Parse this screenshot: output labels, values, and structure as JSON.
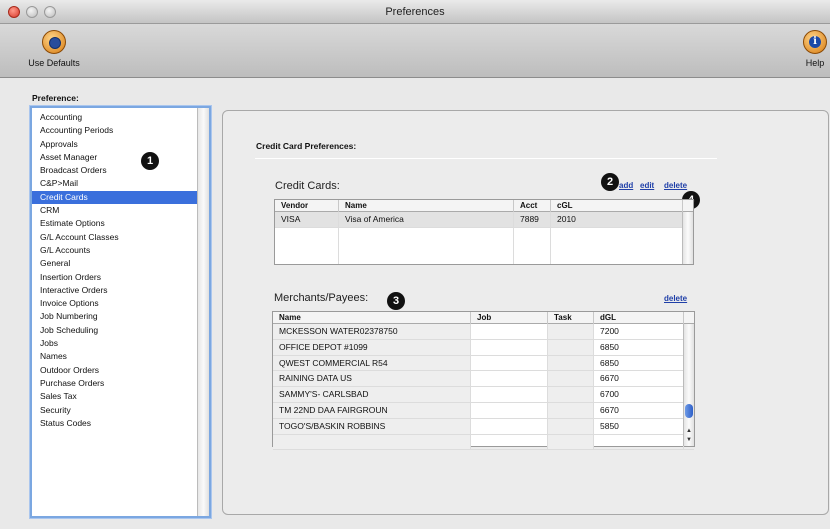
{
  "window": {
    "title": "Preferences"
  },
  "toolbar": {
    "use_defaults_label": "Use Defaults",
    "help_label": "Help"
  },
  "sidebar": {
    "label": "Preference:",
    "items": [
      {
        "label": "Accounting"
      },
      {
        "label": "Accounting Periods"
      },
      {
        "label": "Approvals"
      },
      {
        "label": "Asset Manager"
      },
      {
        "label": "Broadcast Orders"
      },
      {
        "label": "C&P>Mail"
      },
      {
        "label": "Credit Cards"
      },
      {
        "label": "CRM"
      },
      {
        "label": "Estimate Options"
      },
      {
        "label": "G/L Account Classes"
      },
      {
        "label": "G/L Accounts"
      },
      {
        "label": "General"
      },
      {
        "label": "Insertion Orders"
      },
      {
        "label": "Interactive Orders"
      },
      {
        "label": "Invoice Options"
      },
      {
        "label": "Job Numbering"
      },
      {
        "label": "Job Scheduling"
      },
      {
        "label": "Jobs"
      },
      {
        "label": "Names"
      },
      {
        "label": "Outdoor Orders"
      },
      {
        "label": "Purchase Orders"
      },
      {
        "label": "Sales Tax"
      },
      {
        "label": "Security"
      },
      {
        "label": "Status Codes"
      }
    ],
    "selected": "Credit Cards"
  },
  "markers": [
    "1",
    "2",
    "3",
    "4"
  ],
  "main": {
    "title": "Credit Card Preferences:",
    "credit_cards": {
      "title": "Credit Cards:",
      "actions": {
        "add": "add",
        "edit": "edit",
        "delete": "delete"
      },
      "columns": [
        "Vendor",
        "Name",
        "Acct",
        "cGL"
      ],
      "rows": [
        {
          "vendor": "VISA",
          "name": "Visa of America",
          "acct": "7889",
          "cgl": "2010"
        }
      ]
    },
    "merchants": {
      "title": "Merchants/Payees:",
      "actions": {
        "delete": "delete"
      },
      "columns": [
        "Name",
        "Job",
        "Task",
        "dGL"
      ],
      "rows": [
        {
          "name": "MCKESSON WATER02378750",
          "job": "",
          "task": "",
          "dgl": "7200"
        },
        {
          "name": "OFFICE DEPOT #1099",
          "job": "",
          "task": "",
          "dgl": "6850"
        },
        {
          "name": "QWEST COMMERCIAL   R54",
          "job": "",
          "task": "",
          "dgl": "6850"
        },
        {
          "name": "RAINING DATA US",
          "job": "",
          "task": "",
          "dgl": "6670"
        },
        {
          "name": "SAMMY'S- CARLSBAD",
          "job": "",
          "task": "",
          "dgl": "6700"
        },
        {
          "name": "TM  22ND DAA FAIRGROUN",
          "job": "",
          "task": "",
          "dgl": "6670"
        },
        {
          "name": "TOGO'S/BASKIN ROBBINS",
          "job": "",
          "task": "",
          "dgl": "5850"
        }
      ]
    }
  }
}
